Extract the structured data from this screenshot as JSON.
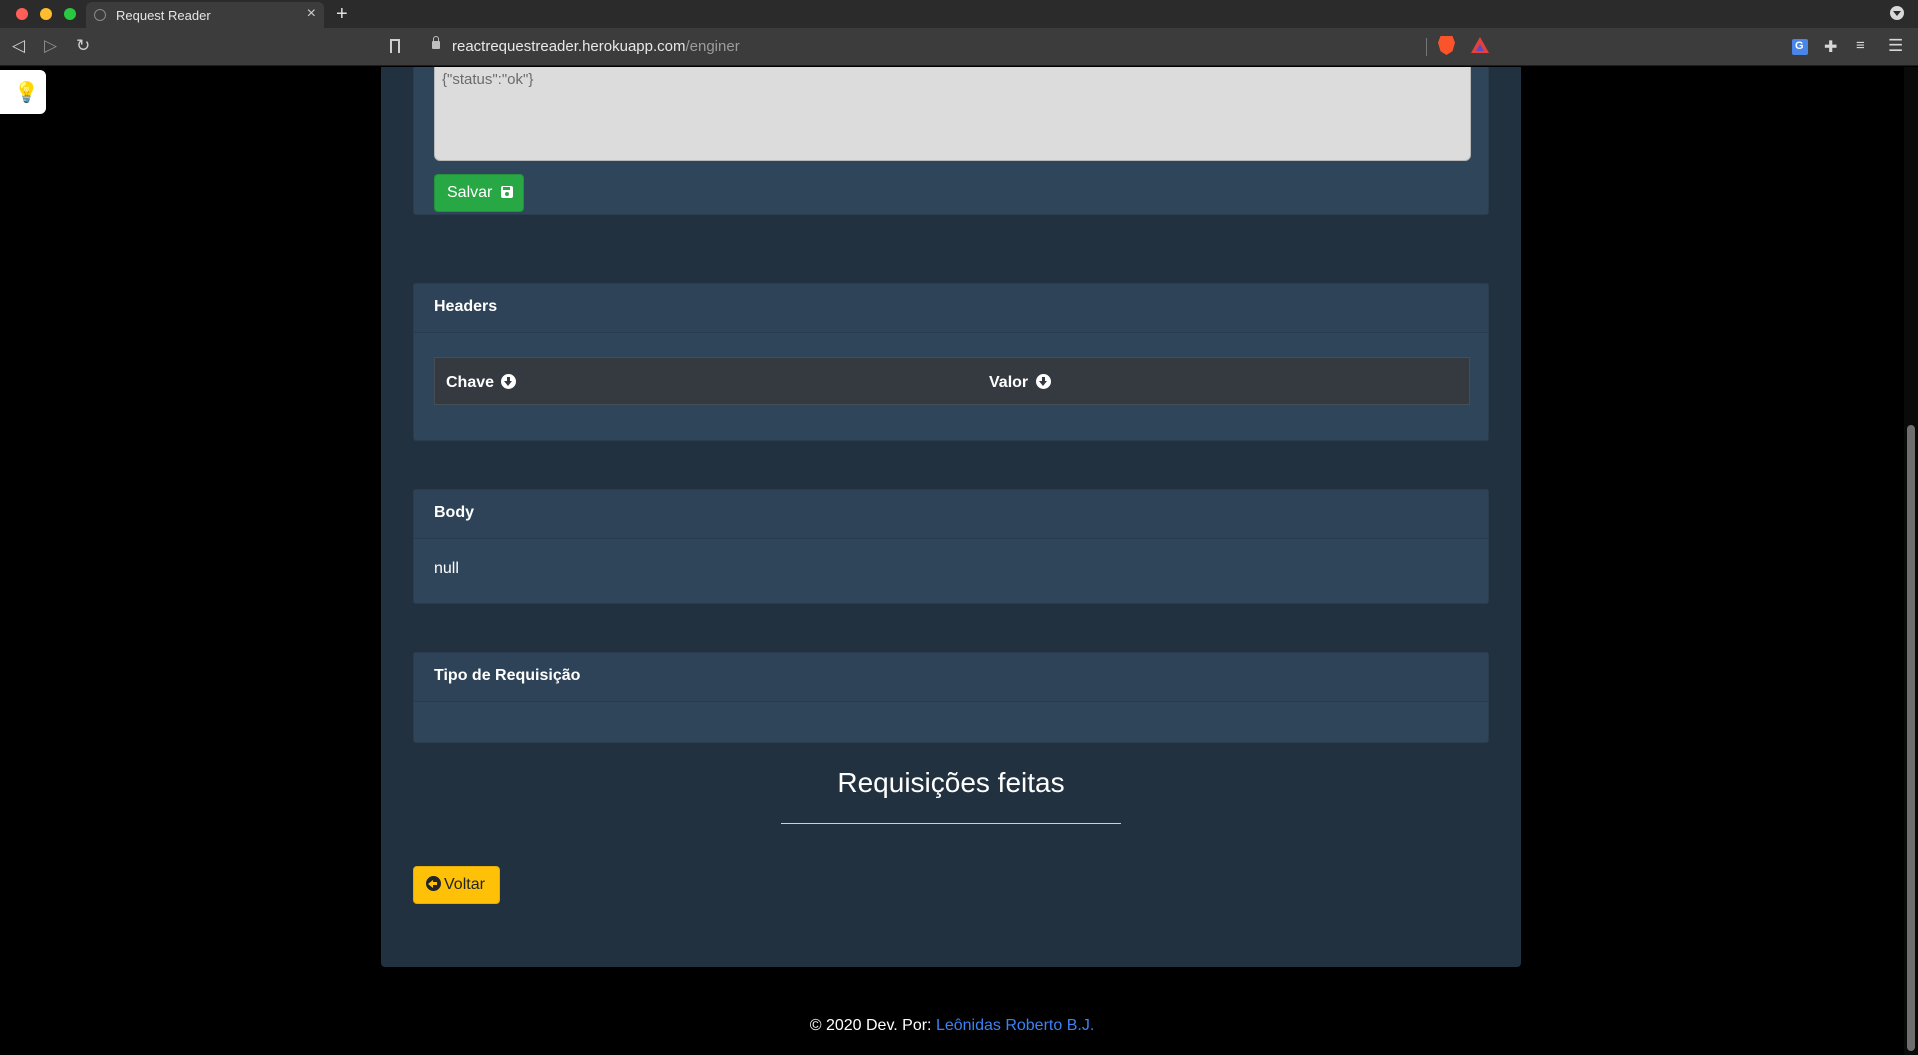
{
  "browser": {
    "tab_title": "Request Reader",
    "new_tab": "+",
    "tab_close": "×",
    "url_host": "reactrequestreader.herokuapp.com",
    "url_path": "/enginer"
  },
  "response": {
    "value": "{\"status\":\"ok\"}",
    "save_label": "Salvar"
  },
  "headers_card": {
    "title": "Headers",
    "columns": [
      "Chave",
      "Valor"
    ]
  },
  "body_card": {
    "title": "Body",
    "content": "null"
  },
  "tipo_card": {
    "title": "Tipo de Requisição"
  },
  "requests_section": {
    "title": "Requisições feitas"
  },
  "back_label": "Voltar",
  "footer": {
    "prefix": "© 2020 Dev. Por: ",
    "author": "Leônidas Roberto B.J."
  },
  "colors": {
    "page_bg": "#000000",
    "container_bg": "#223140",
    "card_bg": "#2f4559",
    "save_button": "#28a745",
    "back_button": "#ffc107",
    "link": "#3b82f6"
  }
}
